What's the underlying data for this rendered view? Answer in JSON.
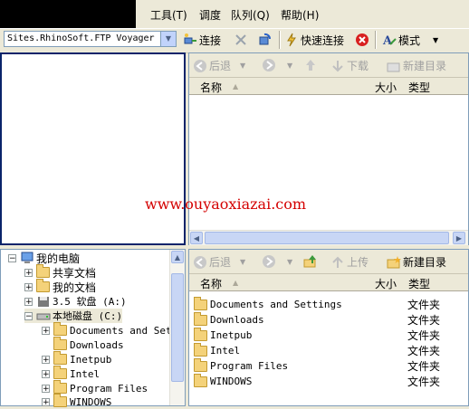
{
  "menu": {
    "items": [
      {
        "label": "工具(T)",
        "name": "menu-tools"
      },
      {
        "label": "调度",
        "name": "menu-schedule"
      },
      {
        "label": "队列(Q)",
        "name": "menu-queue"
      },
      {
        "label": "帮助(H)",
        "name": "menu-help"
      }
    ]
  },
  "toolbar": {
    "site_select": "Sites.RhinoSoft.FTP Voyager",
    "connect_label": "连接",
    "quick_connect_label": "快速连接",
    "mode_label": "模式"
  },
  "remote_pane": {
    "back_label": "后退",
    "download_label": "下载",
    "new_folder_label": "新建目录",
    "col_name": "名称",
    "col_size": "大小",
    "col_type": "类型"
  },
  "watermark": "www.ouyaoxiazai.com",
  "local_pane": {
    "back_label": "后退",
    "upload_label": "上传",
    "new_folder_label": "新建目录",
    "col_name": "名称",
    "col_size": "大小",
    "col_type": "类型",
    "files": [
      {
        "name": "Documents and Settings",
        "type": "文件夹"
      },
      {
        "name": "Downloads",
        "type": "文件夹"
      },
      {
        "name": "Inetpub",
        "type": "文件夹"
      },
      {
        "name": "Intel",
        "type": "文件夹"
      },
      {
        "name": "Program Files",
        "type": "文件夹"
      },
      {
        "name": "WINDOWS",
        "type": "文件夹"
      }
    ]
  },
  "tree": {
    "root": "我的电脑",
    "shared_docs": "共享文档",
    "my_docs": "我的文档",
    "floppy": "3.5 软盘 (A:)",
    "local_disk": "本地磁盘 (C:)",
    "children": [
      "Documents and Set",
      "Downloads",
      "Inetpub",
      "Intel",
      "Program Files",
      "WINDOWS"
    ]
  },
  "colors": {
    "accent": "#0a246a",
    "watermark": "#d40000",
    "folder": "#f4d27a"
  }
}
